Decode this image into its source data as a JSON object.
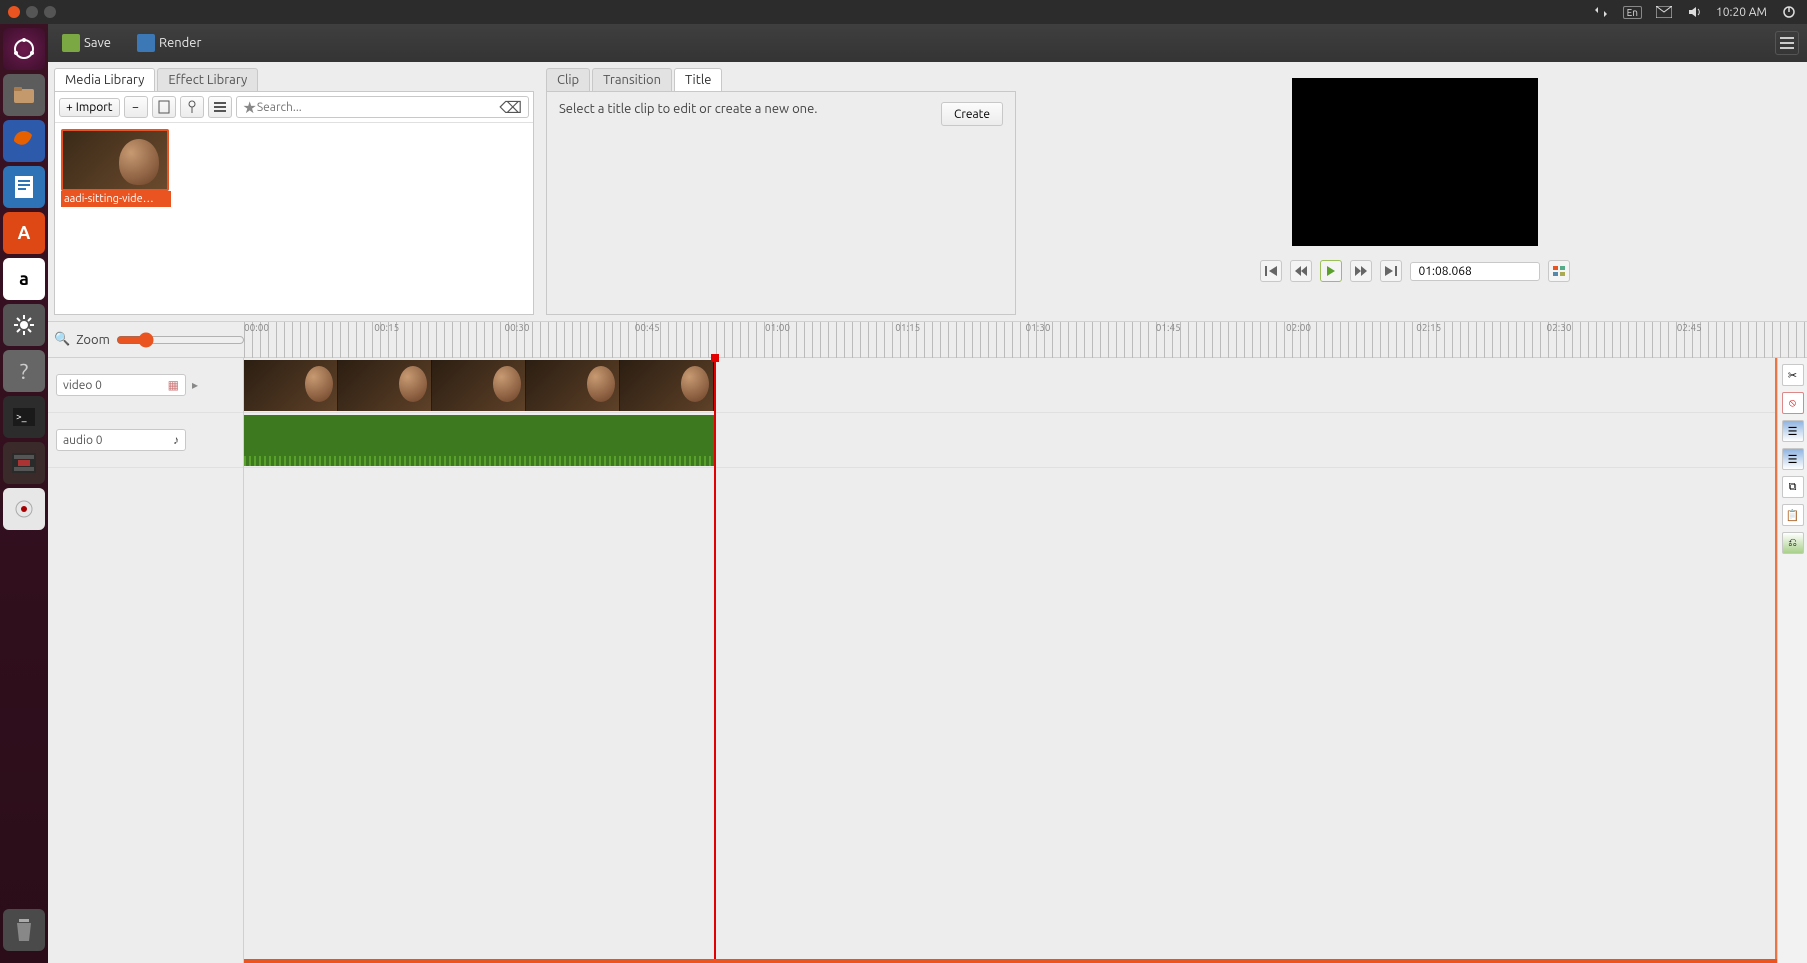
{
  "menubar": {
    "kbd": "En",
    "time": "10:20 AM"
  },
  "toolbar": {
    "save": "Save",
    "render": "Render"
  },
  "media_panel": {
    "tab_media": "Media Library",
    "tab_effect": "Effect Library",
    "import": "Import",
    "search_placeholder": "Search...",
    "clip_name": "aadi-sitting-vide…"
  },
  "props_panel": {
    "tab_clip": "Clip",
    "tab_transition": "Transition",
    "tab_title": "Title",
    "title_msg": "Select a title clip to edit or create a new one.",
    "create": "Create"
  },
  "preview": {
    "timecode": "01:08.068"
  },
  "timeline": {
    "zoom_label": "Zoom",
    "ruler_marks": [
      "00:00",
      "00:15",
      "00:30",
      "00:45",
      "01:00",
      "01:15",
      "01:30",
      "01:45",
      "02:00",
      "02:15",
      "02:30",
      "02:45"
    ],
    "tracks": {
      "video": "video 0",
      "audio": "audio 0"
    }
  }
}
